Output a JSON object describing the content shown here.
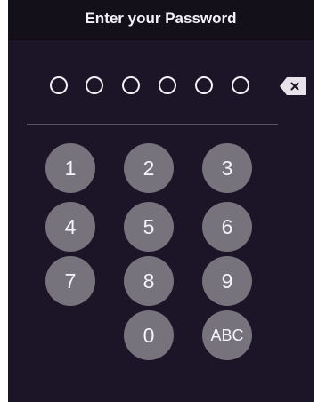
{
  "header": {
    "title": "Enter your Password"
  },
  "pin": {
    "length": 6,
    "entered": 0
  },
  "keypad": {
    "keys": [
      {
        "label": "1",
        "name": "key-1"
      },
      {
        "label": "2",
        "name": "key-2"
      },
      {
        "label": "3",
        "name": "key-3"
      },
      {
        "label": "4",
        "name": "key-4"
      },
      {
        "label": "5",
        "name": "key-5"
      },
      {
        "label": "6",
        "name": "key-6"
      },
      {
        "label": "7",
        "name": "key-7"
      },
      {
        "label": "8",
        "name": "key-8"
      },
      {
        "label": "9",
        "name": "key-9"
      },
      {
        "label": "0",
        "name": "key-0"
      },
      {
        "label": "ABC",
        "name": "key-abc"
      }
    ]
  },
  "colors": {
    "background": "#1c1528",
    "header_background": "#141019",
    "key_fill": "#77737d",
    "dot_outline": "#f2f0f5",
    "backspace_fill": "#e6e3ea"
  },
  "icons": {
    "backspace": "backspace-icon"
  }
}
